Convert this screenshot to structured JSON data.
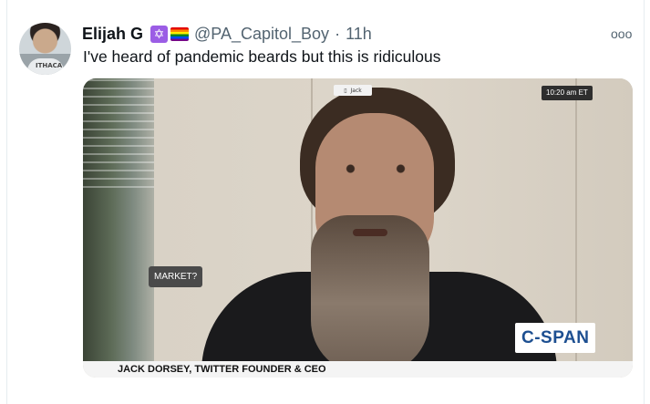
{
  "tweet": {
    "author_name": "Elijah G",
    "badges": [
      "star-of-david-emoji",
      "rainbow-flag-emoji"
    ],
    "handle": "@PA_Capitol_Boy",
    "separator": "·",
    "time": "11h",
    "text": "I've heard of pandemic beards but this is ridiculous",
    "more_icon": "ooo"
  },
  "avatar": {
    "shirt_text": "ITHACA"
  },
  "media": {
    "camera_label": "Jack",
    "time_overlay": "10:20 am ET",
    "question_overlay": "MARKET?",
    "network_logo": "C-SPAN",
    "caption": "JACK DORSEY, TWITTER FOUNDER & CEO"
  },
  "colors": {
    "text": "#0f1419",
    "muted": "#536471",
    "cspan_blue": "#1d4f91"
  }
}
